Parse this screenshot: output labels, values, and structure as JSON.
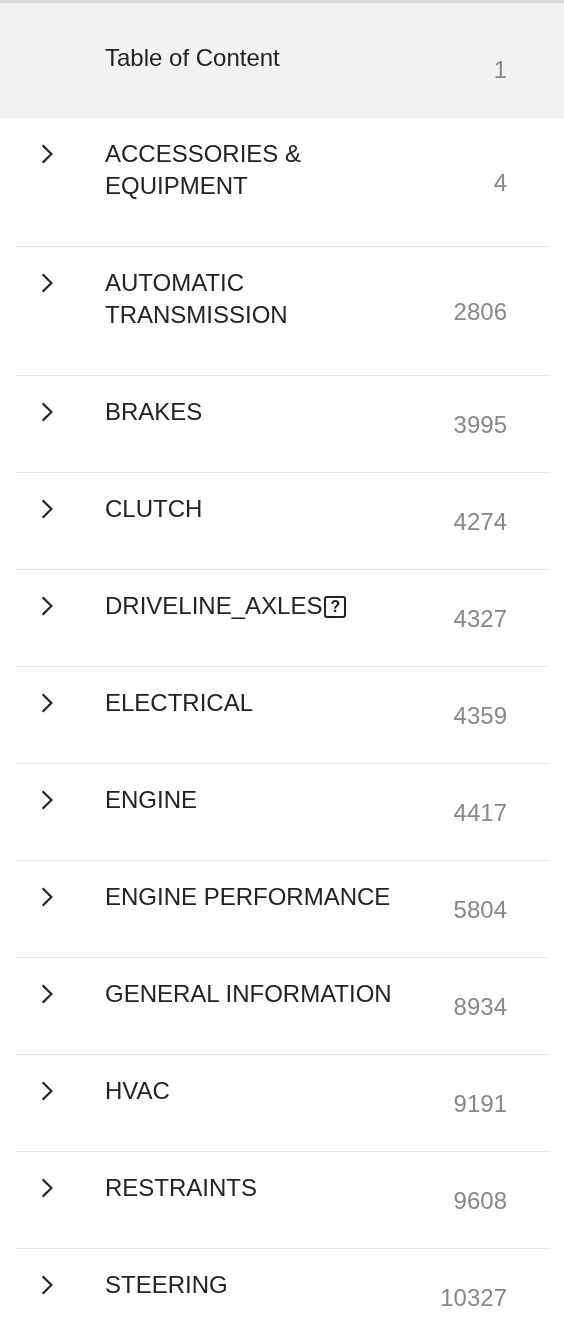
{
  "header": {
    "title": "Table of Content",
    "page": "1"
  },
  "sections": [
    {
      "title": "ACCESSORIES & EQUIPMENT",
      "page": "4",
      "expanded": false
    },
    {
      "title": "AUTOMATIC TRANSMISSION",
      "page": "2806",
      "expanded": false
    },
    {
      "title": "BRAKES",
      "page": "3995",
      "expanded": false
    },
    {
      "title": "CLUTCH",
      "page": "4274",
      "expanded": false
    },
    {
      "title": "DRIVELINE_AXLES",
      "badge": "?",
      "page": "4327",
      "expanded": false
    },
    {
      "title": "ELECTRICAL",
      "page": "4359",
      "expanded": false
    },
    {
      "title": "ENGINE",
      "page": "4417",
      "expanded": false
    },
    {
      "title": "ENGINE PERFORMANCE",
      "page": "5804",
      "expanded": false
    },
    {
      "title": "GENERAL INFORMATION",
      "page": "8934",
      "expanded": false
    },
    {
      "title": "HVAC",
      "page": "9191",
      "expanded": false
    },
    {
      "title": "RESTRAINTS",
      "page": "9608",
      "expanded": false
    },
    {
      "title": "STEERING",
      "page": "10327",
      "expanded": false
    }
  ]
}
